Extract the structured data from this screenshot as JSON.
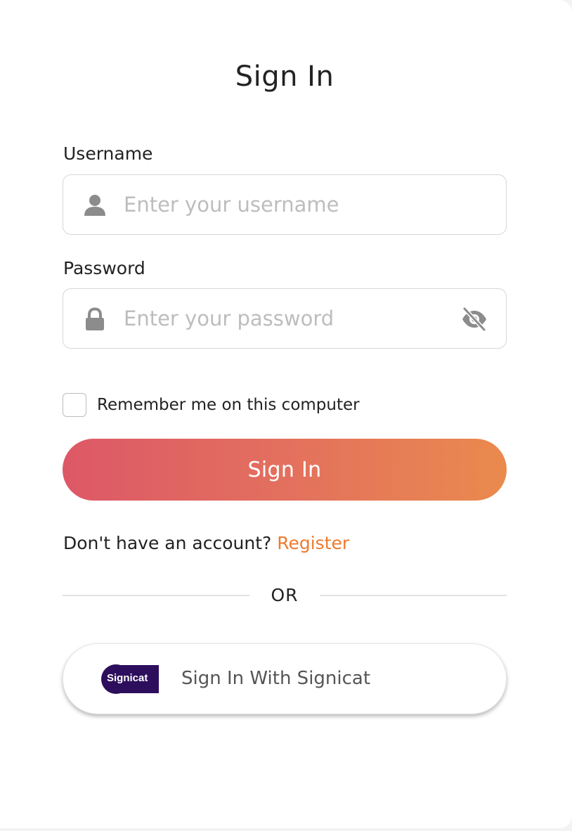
{
  "page": {
    "title": "Sign In"
  },
  "form": {
    "username": {
      "label": "Username",
      "placeholder": "Enter your username",
      "value": "",
      "icon": "user-icon"
    },
    "password": {
      "label": "Password",
      "placeholder": "Enter your password",
      "value": "",
      "icon": "lock-icon",
      "toggle_icon": "eye-slash-icon"
    },
    "remember": {
      "label": "Remember me on this computer",
      "checked": false
    },
    "submit_label": "Sign In"
  },
  "register": {
    "prompt": "Don't have an account?",
    "link_label": "Register"
  },
  "divider": {
    "text": "OR"
  },
  "sso": {
    "logo_text": "Signicat",
    "label": "Sign In With Signicat"
  },
  "colors": {
    "accent": "#ef7a2e",
    "button_gradient_start": "#dd5867",
    "button_gradient_end": "#ea8a4d",
    "signicat_brand": "#2d0e5c"
  }
}
